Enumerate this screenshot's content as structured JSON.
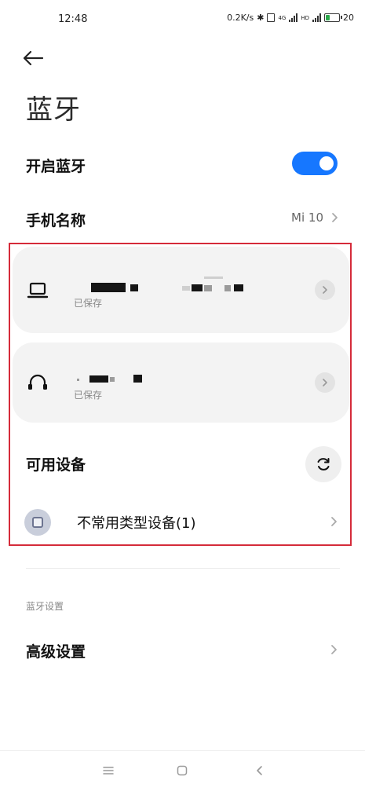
{
  "status_bar": {
    "time": "12:48",
    "net_speed": "0.2K/s",
    "signal_1_label": "4G",
    "signal_2_label": "HD",
    "battery": "20"
  },
  "header": {
    "title": "蓝牙"
  },
  "settings": {
    "bluetooth_label": "开启蓝牙",
    "bluetooth_on": true,
    "phone_name_label": "手机名称",
    "phone_name_value": "Mi 10"
  },
  "saved_devices": [
    {
      "icon": "laptop-icon",
      "status": "已保存"
    },
    {
      "icon": "headphones-icon",
      "status": "已保存"
    }
  ],
  "available": {
    "title": "可用设备",
    "uncommon_label": "不常用类型设备(1)"
  },
  "bluetooth_settings": {
    "section_label": "蓝牙设置",
    "advanced_label": "高级设置"
  },
  "colors": {
    "accent": "#1677ff",
    "highlight_border": "#d52b3a",
    "card_bg": "#f3f3f3"
  }
}
